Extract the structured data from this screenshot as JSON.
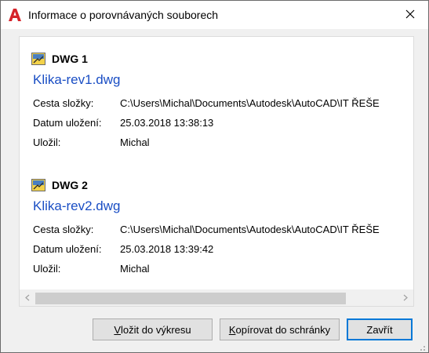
{
  "window": {
    "title": "Informace o porovnávaných souborech"
  },
  "icons": {
    "app": "autocad-logo-icon",
    "close": "close-icon",
    "dwg": "dwg-file-icon"
  },
  "colors": {
    "link": "#1a4ec4",
    "app_red": "#d5232a",
    "default_button_border": "#0078d7"
  },
  "labels": {
    "path": "Cesta složky:",
    "saved_date": "Datum uložení:",
    "saved_by": "Uložil:"
  },
  "drawings": [
    {
      "title": "DWG 1",
      "file": "Klika-rev1.dwg",
      "path": "C:\\Users\\Michal\\Documents\\Autodesk\\AutoCAD\\IT ŘEŠE",
      "saved_date": "25.03.2018 13:38:13",
      "saved_by": "Michal"
    },
    {
      "title": "DWG 2",
      "file": "Klika-rev2.dwg",
      "path": "C:\\Users\\Michal\\Documents\\Autodesk\\AutoCAD\\IT ŘEŠE",
      "saved_date": "25.03.2018 13:39:42",
      "saved_by": "Michal"
    }
  ],
  "buttons": {
    "insert_pre": "V",
    "insert_post": "ložit do výkresu",
    "copy_pre": "K",
    "copy_post": "opírovat do schránky",
    "close": "Zavřít"
  }
}
